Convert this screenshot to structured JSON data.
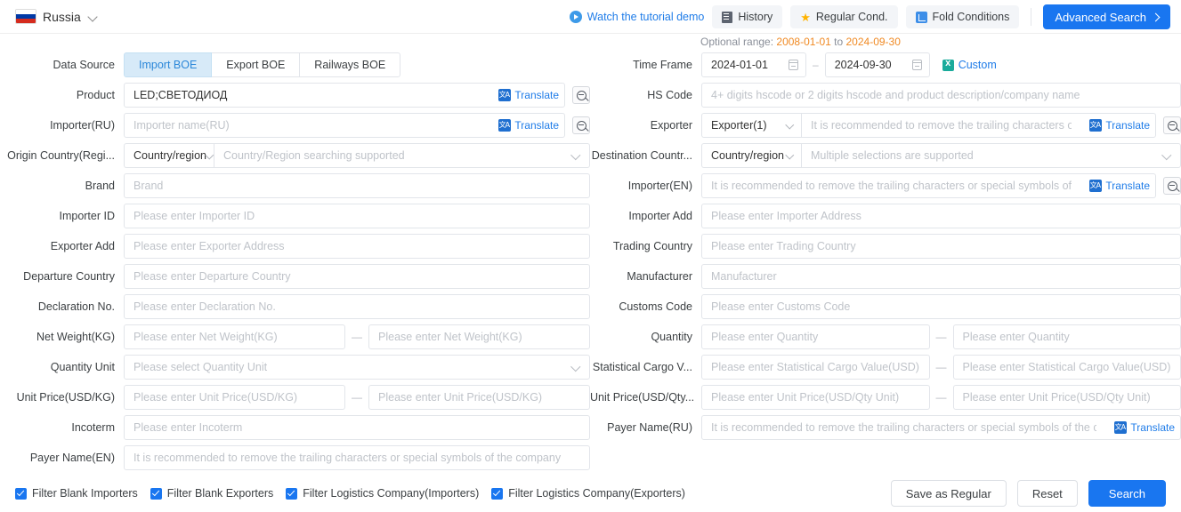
{
  "topbar": {
    "country": "Russia",
    "flag_colors": [
      "#ffffff",
      "#0039a6",
      "#d52b1e"
    ],
    "tutorial_label": "Watch the tutorial demo",
    "history_label": "History",
    "regular_cond_label": "Regular Cond.",
    "fold_conditions_label": "Fold Conditions",
    "advanced_search_label": "Advanced Search"
  },
  "optional_range": {
    "prefix": "Optional range:",
    "start": "2008-01-01",
    "middle": "to",
    "end": "2024-09-30"
  },
  "accent": {
    "primary": "#1976f0",
    "link": "#1f7ce8",
    "orange": "#f08a24",
    "tab_active_bg": "#d7eaf8",
    "tab_active_text": "#2b87d9"
  },
  "data_source": {
    "label": "Data Source",
    "tabs": [
      {
        "label": "Import BOE",
        "active": true
      },
      {
        "label": "Export BOE",
        "active": false
      },
      {
        "label": "Railways BOE",
        "active": false
      }
    ]
  },
  "time_frame": {
    "label": "Time Frame",
    "start": "2024-01-01",
    "end": "2024-09-30",
    "separator": "–",
    "custom_label": "Custom"
  },
  "translate_label": "Translate",
  "left_fields": [
    {
      "label": "Product",
      "value": "LED;СВЕТОДИОД",
      "placeholder": "",
      "translate": true,
      "fuzzy": true
    },
    {
      "label": "Importer(RU)",
      "value": "",
      "placeholder": "Importer name(RU)",
      "translate": true,
      "fuzzy": true
    },
    {
      "label": "Origin Country(Regi...",
      "prefix": "Country/region",
      "placeholder": "Country/Region searching supported",
      "select": true
    },
    {
      "label": "Brand",
      "value": "",
      "placeholder": "Brand"
    },
    {
      "label": "Importer ID",
      "value": "",
      "placeholder": "Please enter Importer ID"
    },
    {
      "label": "Exporter Add",
      "value": "",
      "placeholder": "Please enter Exporter Address"
    },
    {
      "label": "Departure Country",
      "value": "",
      "placeholder": "Please enter Departure Country"
    },
    {
      "label": "Declaration No.",
      "value": "",
      "placeholder": "Please enter Declaration No."
    },
    {
      "label": "Net Weight(KG)",
      "placeholder_from": "Please enter Net Weight(KG)",
      "placeholder_to": "Please enter Net Weight(KG)",
      "range": true
    },
    {
      "label": "Quantity Unit",
      "value": "",
      "placeholder": "Please select Quantity Unit",
      "dropdown": true
    },
    {
      "label": "Unit Price(USD/KG)",
      "placeholder_from": "Please enter Unit Price(USD/KG)",
      "placeholder_to": "Please enter Unit Price(USD/KG)",
      "range": true
    },
    {
      "label": "Incoterm",
      "value": "",
      "placeholder": "Please enter Incoterm"
    },
    {
      "label": "Payer Name(EN)",
      "value": "",
      "placeholder": "It is recommended to remove the trailing characters or special symbols of the company"
    }
  ],
  "right_fields": [
    {
      "label": "HS Code",
      "value": "",
      "placeholder": "4+ digits hscode or 2 digits hscode and product description/company name"
    },
    {
      "label": "Exporter",
      "prefix": "Exporter(1)",
      "placeholder": "It is recommended to remove the trailing characters or special symbols of the company",
      "translate": true,
      "fuzzy": true,
      "select": true
    },
    {
      "label": "Destination Countr...",
      "prefix": "Country/region",
      "placeholder": "Multiple selections are supported",
      "select": true
    },
    {
      "label": "Importer(EN)",
      "value": "",
      "placeholder": "It is recommended to remove the trailing characters or special symbols of the company",
      "translate": true,
      "fuzzy": true
    },
    {
      "label": "Importer Add",
      "value": "",
      "placeholder": "Please enter Importer Address"
    },
    {
      "label": "Trading Country",
      "value": "",
      "placeholder": "Please enter Trading Country"
    },
    {
      "label": "Manufacturer",
      "value": "",
      "placeholder": "Manufacturer"
    },
    {
      "label": "Customs Code",
      "value": "",
      "placeholder": "Please enter Customs Code"
    },
    {
      "label": "Quantity",
      "placeholder_from": "Please enter Quantity",
      "placeholder_to": "Please enter Quantity",
      "range": true
    },
    {
      "label": "Statistical Cargo V...",
      "placeholder_from": "Please enter Statistical Cargo Value(USD)",
      "placeholder_to": "Please enter Statistical Cargo Value(USD)",
      "range": true
    },
    {
      "label": "Unit Price(USD/Qty...",
      "placeholder_from": "Please enter Unit Price(USD/Qty Unit)",
      "placeholder_to": "Please enter Unit Price(USD/Qty Unit)",
      "range": true
    },
    {
      "label": "Payer Name(RU)",
      "value": "",
      "placeholder": "It is recommended to remove the trailing characters or special symbols of the company",
      "translate": true
    }
  ],
  "footer": {
    "checkboxes": [
      {
        "label": "Filter Blank Importers",
        "checked": true
      },
      {
        "label": "Filter Blank Exporters",
        "checked": true
      },
      {
        "label": "Filter Logistics Company(Importers)",
        "checked": true
      },
      {
        "label": "Filter Logistics Company(Exporters)",
        "checked": true
      }
    ],
    "save_label": "Save as Regular",
    "reset_label": "Reset",
    "search_label": "Search"
  }
}
